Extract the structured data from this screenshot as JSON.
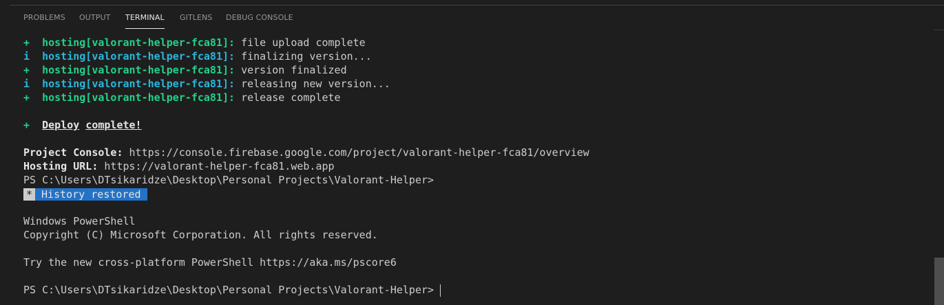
{
  "tabs": [
    {
      "label": "PROBLEMS"
    },
    {
      "label": "OUTPUT"
    },
    {
      "label": "TERMINAL"
    },
    {
      "label": "GITLENS"
    },
    {
      "label": "DEBUG CONSOLE"
    }
  ],
  "active_tab": "TERMINAL",
  "terminal": {
    "hosting_lines": [
      {
        "symbol": "+",
        "target": "hosting[valorant-helper-fca81]:",
        "message": " file upload complete"
      },
      {
        "symbol": "i",
        "target": "hosting[valorant-helper-fca81]:",
        "message": " finalizing version..."
      },
      {
        "symbol": "+",
        "target": "hosting[valorant-helper-fca81]:",
        "message": " version finalized"
      },
      {
        "symbol": "i",
        "target": "hosting[valorant-helper-fca81]:",
        "message": " releasing new version..."
      },
      {
        "symbol": "+",
        "target": "hosting[valorant-helper-fca81]:",
        "message": " release complete"
      }
    ],
    "deploy_symbol": "+",
    "deploy_word1": "Deploy",
    "deploy_word2": "complete!",
    "project_console_label": "Project Console:",
    "project_console_url": " https://console.firebase.google.com/project/valorant-helper-fca81/overview",
    "hosting_url_label": "Hosting URL:",
    "hosting_url": " https://valorant-helper-fca81.web.app",
    "prompt1": "PS C:\\Users\\DTsikaridze\\Desktop\\Personal Projects\\Valorant-Helper>",
    "history_star": "*",
    "history_label": "History restored",
    "ps_title": "Windows PowerShell",
    "copyright": "Copyright (C) Microsoft Corporation. All rights reserved.",
    "try_line": "Try the new cross-platform PowerShell https://aka.ms/pscore6",
    "prompt2": "PS C:\\Users\\DTsikaridze\\Desktop\\Personal Projects\\Valorant-Helper> "
  },
  "colors": {
    "background": "#1e1e1e",
    "success_green": "#23d18b",
    "info_cyan": "#29b8db",
    "history_badge": "#2472c8",
    "text": "#cccccc"
  }
}
